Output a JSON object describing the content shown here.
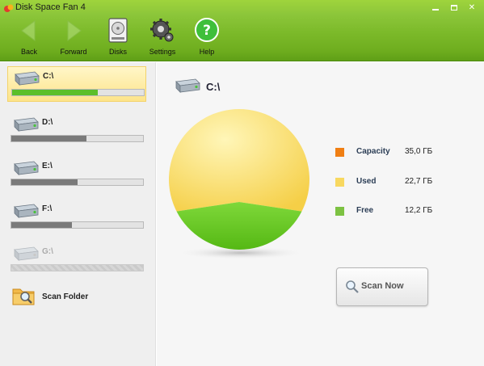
{
  "window": {
    "title": "Disk Space Fan 4"
  },
  "toolbar": {
    "back": "Back",
    "forward": "Forward",
    "disks": "Disks",
    "settings": "Settings",
    "help": "Help"
  },
  "sidebar": {
    "disks": [
      {
        "name": "C:\\",
        "used_fraction": 0.65,
        "selected": true,
        "available": true
      },
      {
        "name": "D:\\",
        "used_fraction": 0.57,
        "selected": false,
        "available": true
      },
      {
        "name": "E:\\",
        "used_fraction": 0.5,
        "selected": false,
        "available": true
      },
      {
        "name": "F:\\",
        "used_fraction": 0.46,
        "selected": false,
        "available": true
      },
      {
        "name": "G:\\",
        "used_fraction": 0.0,
        "selected": false,
        "available": false
      }
    ],
    "scan_folder": "Scan Folder"
  },
  "main": {
    "drive_name": "C:\\",
    "legend": [
      {
        "label": "Capacity",
        "value": "35,0 ГБ",
        "color": "#f07f13"
      },
      {
        "label": "Used",
        "value": "22,7 ГБ",
        "color": "#f8d860"
      },
      {
        "label": "Free",
        "value": "12,2 ГБ",
        "color": "#7dc242"
      }
    ],
    "scan_now": "Scan Now"
  },
  "chart_data": {
    "type": "pie",
    "categories": [
      "Used",
      "Free"
    ],
    "values": [
      22.7,
      12.2
    ],
    "colors": [
      "#f8d860",
      "#6ac825"
    ]
  },
  "colors": {
    "toolbar_green": "#7cba2a",
    "selected_bar": "#5cbf2a",
    "selected_bg": "#fde48a"
  }
}
